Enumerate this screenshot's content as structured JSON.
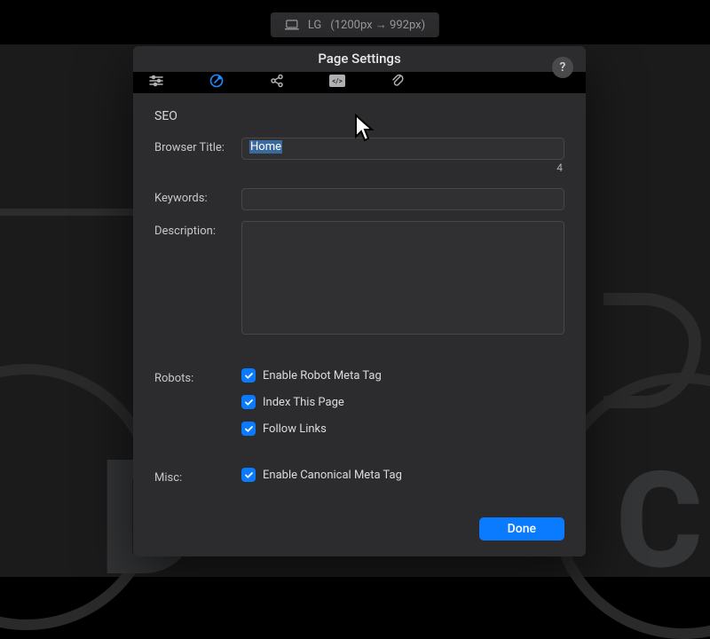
{
  "breakpoint": {
    "device": "LG",
    "range": "(1200px → 992px)"
  },
  "panel": {
    "title": "Page Settings",
    "help_label": "?"
  },
  "tabs": {
    "sliders": "sliders-icon",
    "seo": "target-icon",
    "social": "share-icon",
    "code": "code-icon",
    "attach": "paperclip-icon"
  },
  "seo": {
    "section_title": "SEO",
    "labels": {
      "browser_title": "Browser Title:",
      "keywords": "Keywords:",
      "description": "Description:",
      "robots": "Robots:",
      "misc": "Misc:"
    },
    "values": {
      "browser_title": "Home",
      "browser_title_count": "4",
      "keywords": "",
      "description": ""
    },
    "checkboxes": {
      "enable_robot": "Enable Robot Meta Tag",
      "index_page": "Index This Page",
      "follow_links": "Follow Links",
      "enable_canonical": "Enable Canonical Meta Tag"
    }
  },
  "footer": {
    "done": "Done"
  }
}
